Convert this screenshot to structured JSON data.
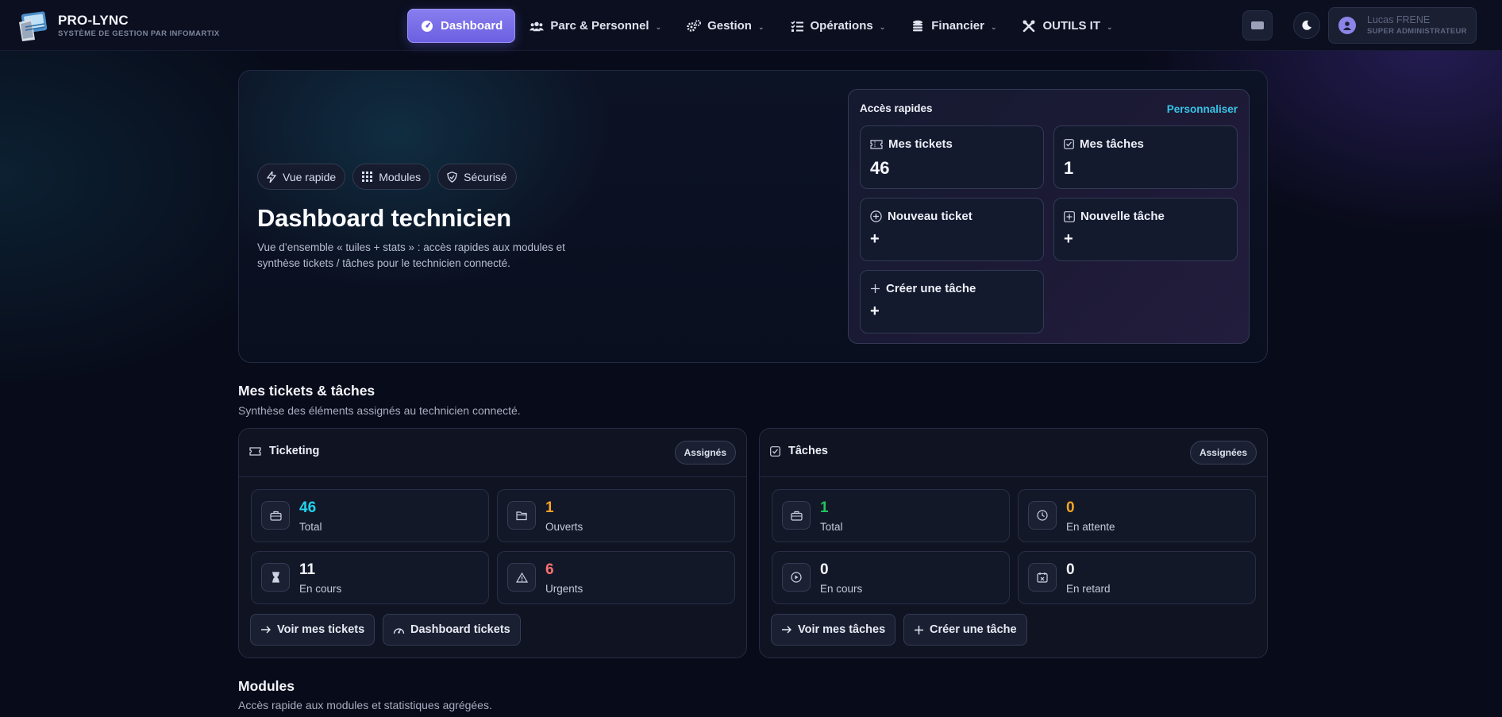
{
  "brand": {
    "name": "PRO-LYNC",
    "subtitle": "SYSTÈME DE GESTION PAR INFOMARTIX"
  },
  "nav": {
    "items": [
      {
        "label": "Dashboard",
        "icon": "gauge-icon",
        "active": true
      },
      {
        "label": "Parc & Personnel",
        "icon": "users-icon"
      },
      {
        "label": "Gestion",
        "icon": "gears-icon"
      },
      {
        "label": "Opérations",
        "icon": "checklist-icon"
      },
      {
        "label": "Financier",
        "icon": "coins-icon"
      },
      {
        "label": "OUTILS IT",
        "icon": "tools-icon"
      }
    ]
  },
  "user": {
    "name": "Lucas FRENE",
    "role": "SUPER ADMINISTRATEUR"
  },
  "hero": {
    "chips": [
      "Vue rapide",
      "Modules",
      "Sécurisé"
    ],
    "title": "Dashboard technicien",
    "description": "Vue d’ensemble « tuiles + stats » : accès rapides aux modules et synthèse tickets / tâches pour le technicien connecté."
  },
  "quick_access": {
    "title": "Accès rapides",
    "customize": "Personnaliser",
    "tiles": [
      {
        "label": "Mes tickets",
        "value": "46",
        "icon": "ticket-icon"
      },
      {
        "label": "Mes tâches",
        "value": "1",
        "icon": "checkbox-icon"
      },
      {
        "label": "Nouveau ticket",
        "value": "+",
        "icon": "plus-circle-icon"
      },
      {
        "label": "Nouvelle tâche",
        "value": "+",
        "icon": "plus-square-icon"
      },
      {
        "label": "Créer une tâche",
        "value": "+",
        "icon": "plus-icon"
      }
    ]
  },
  "section_tickets": {
    "title": "Mes tickets & tâches",
    "subtitle": "Synthèse des éléments assignés au technicien connecté."
  },
  "ticketing": {
    "title": "Ticketing",
    "badge": "Assignés",
    "stats": [
      {
        "value": "46",
        "label": "Total",
        "color": "#22d3ee",
        "icon": "briefcase-icon"
      },
      {
        "value": "1",
        "label": "Ouverts",
        "color": "#f5a524",
        "icon": "folder-open-icon"
      },
      {
        "value": "11",
        "label": "En cours",
        "color": "#f3f4f8",
        "icon": "hourglass-icon"
      },
      {
        "value": "6",
        "label": "Urgents",
        "color": "#f87171",
        "icon": "warning-icon"
      }
    ],
    "actions": [
      "Voir mes tickets",
      "Dashboard tickets"
    ]
  },
  "taches": {
    "title": "Tâches",
    "badge": "Assignées",
    "stats": [
      {
        "value": "1",
        "label": "Total",
        "color": "#22c55e",
        "icon": "briefcase-icon"
      },
      {
        "value": "0",
        "label": "En attente",
        "color": "#f5a524",
        "icon": "clock-icon"
      },
      {
        "value": "0",
        "label": "En cours",
        "color": "#f3f4f8",
        "icon": "play-circle-icon"
      },
      {
        "value": "0",
        "label": "En retard",
        "color": "#f3f4f8",
        "icon": "calendar-x-icon"
      }
    ],
    "actions": [
      "Voir mes tâches",
      "Créer une tâche"
    ]
  },
  "section_modules": {
    "title": "Modules",
    "subtitle": "Accès rapide aux modules et statistiques agrégées."
  }
}
